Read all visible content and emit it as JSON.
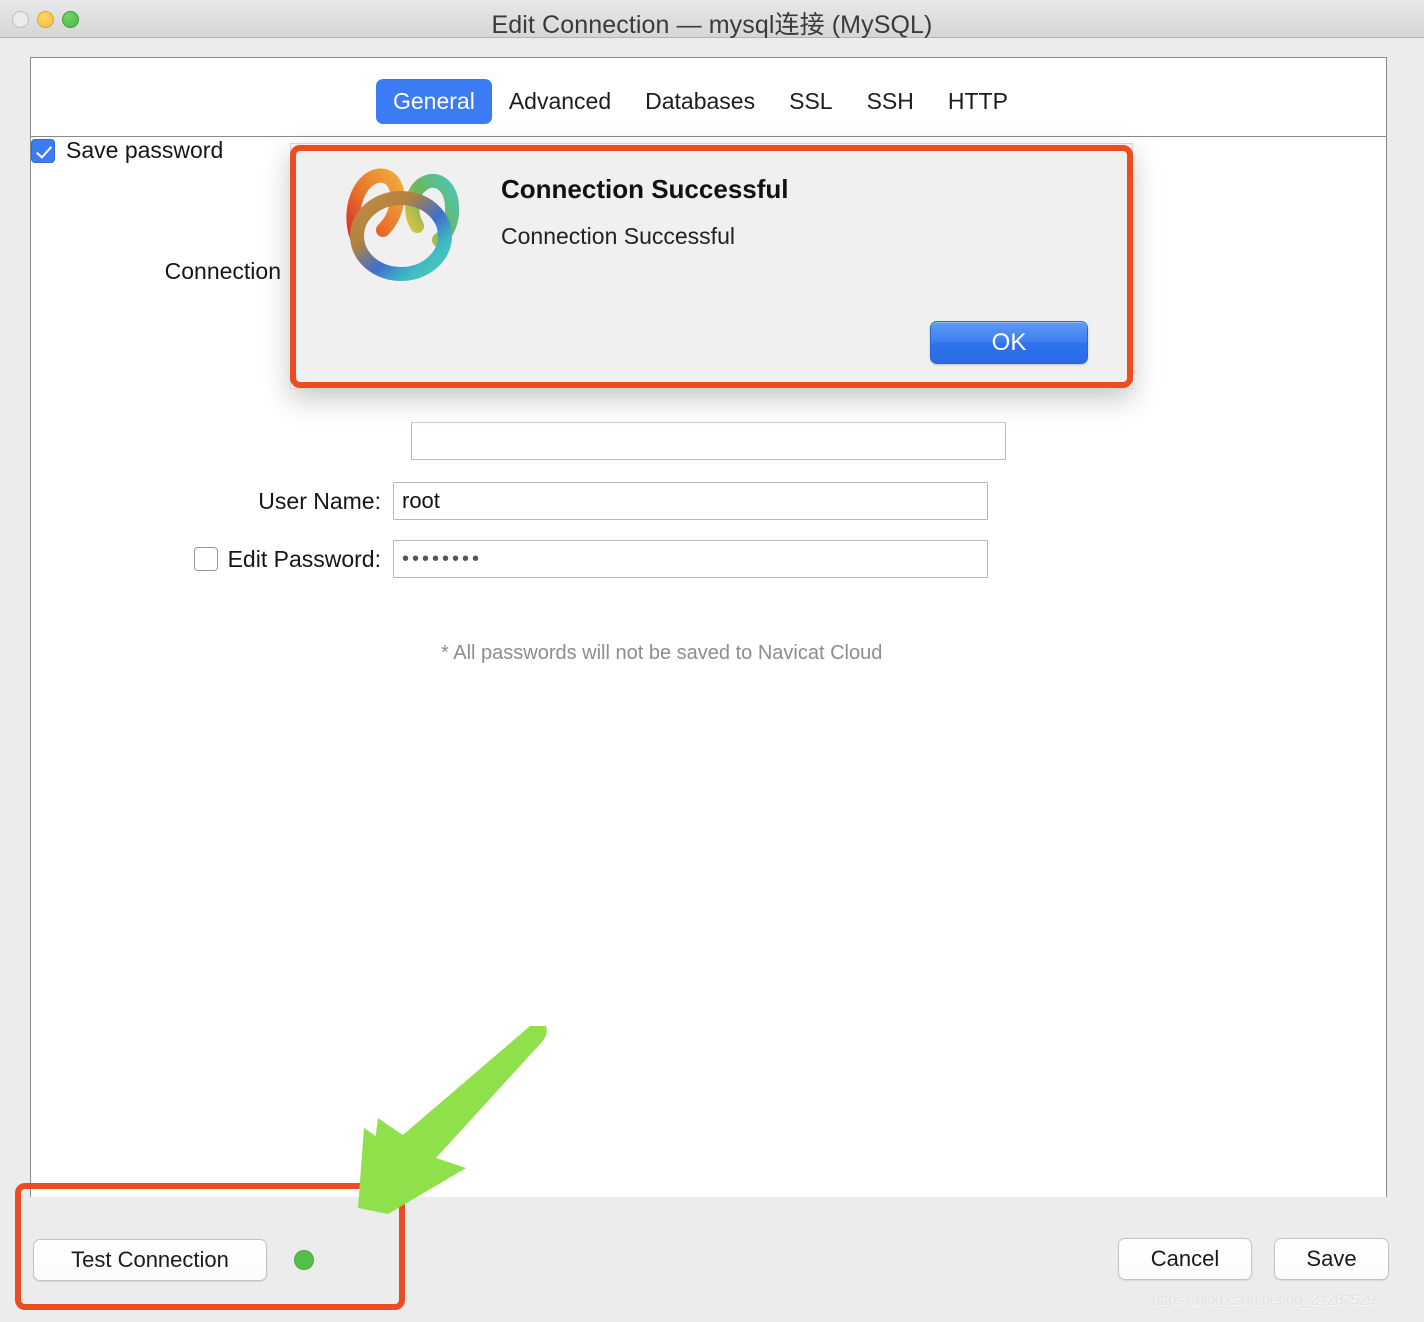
{
  "window": {
    "title": "Edit Connection — mysql连接 (MySQL)",
    "traffic_lights": [
      "close-button",
      "minimize-button",
      "maximize-button"
    ]
  },
  "tabs": [
    {
      "label": "General",
      "active": true
    },
    {
      "label": "Advanced",
      "active": false
    },
    {
      "label": "Databases",
      "active": false
    },
    {
      "label": "SSL",
      "active": false
    },
    {
      "label": "SSH",
      "active": false
    },
    {
      "label": "HTTP",
      "active": false
    }
  ],
  "form": {
    "connection_name": {
      "label": "Connection",
      "value": ""
    },
    "hidden_field": {
      "value": ""
    },
    "user_name": {
      "label": "User Name:",
      "value": "root"
    },
    "edit_password": {
      "label": "Edit Password:",
      "value": "••••••••",
      "checked": false
    },
    "save_password": {
      "label": "Save password",
      "checked": true
    },
    "cloud_note": "* All passwords will not be saved to Navicat Cloud"
  },
  "footer": {
    "test_connection_label": "Test Connection",
    "status_dot_color": "#55be4c",
    "cancel_label": "Cancel",
    "save_label": "Save",
    "watermark": "https://blog.csdn.net/qq_24287529"
  },
  "alert": {
    "title": "Connection Successful",
    "message": "Connection Successful",
    "ok_label": "OK",
    "icon": "navicat-logo"
  },
  "annotations": {
    "highlight_color": "#ed4b20",
    "arrow_color": "#8fe04a"
  }
}
